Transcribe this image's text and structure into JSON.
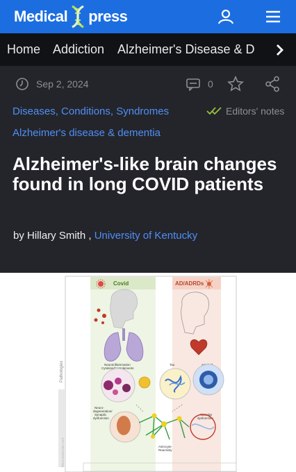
{
  "header": {
    "logo_left": "Medical",
    "logo_right": "press"
  },
  "nav": {
    "items": [
      "Home",
      "Addiction",
      "Alzheimer's Disease & D"
    ]
  },
  "article": {
    "date": "Sep 2, 2024",
    "comment_count": "0",
    "tags": [
      "Diseases, Conditions, Syndromes",
      "Alzheimer's disease & dementia"
    ],
    "editors_notes": "Editors' notes",
    "title": "Alzheimer's-like brain changes found in long COVID patients",
    "byline_prefix": "by",
    "author": "Hillary Smith",
    "separator": ",",
    "institution": "University of Kentucky"
  },
  "figure": {
    "left_panel_title": "Covid",
    "right_panel_title": "AD/ADRDs",
    "axis_label": "Pathologies",
    "axis_label_2": "Neurovascular-unit",
    "label_neuroinflammation": "Neuroinflammation",
    "label_cytokine": "Cytokine/Complements",
    "label_tau": "Tau",
    "label_amyloid": "Amyloid",
    "label_neurodegeneration": "Neuro-",
    "label_neurodegeneration_2": "degeneration/",
    "label_synaptic": "Synaptic",
    "label_dysfunction": "dysfunction",
    "label_vascular": "Vascular",
    "label_vascular_2": "dysfunction",
    "label_astrocyte": "Astrocyte",
    "label_reactivity": "Reactivity"
  },
  "colors": {
    "brand_blue": "#1c6ee0",
    "link_blue": "#4f8ff7",
    "background": "#24252b",
    "nav_background": "#111216",
    "editors_check": "#9ac23c"
  }
}
